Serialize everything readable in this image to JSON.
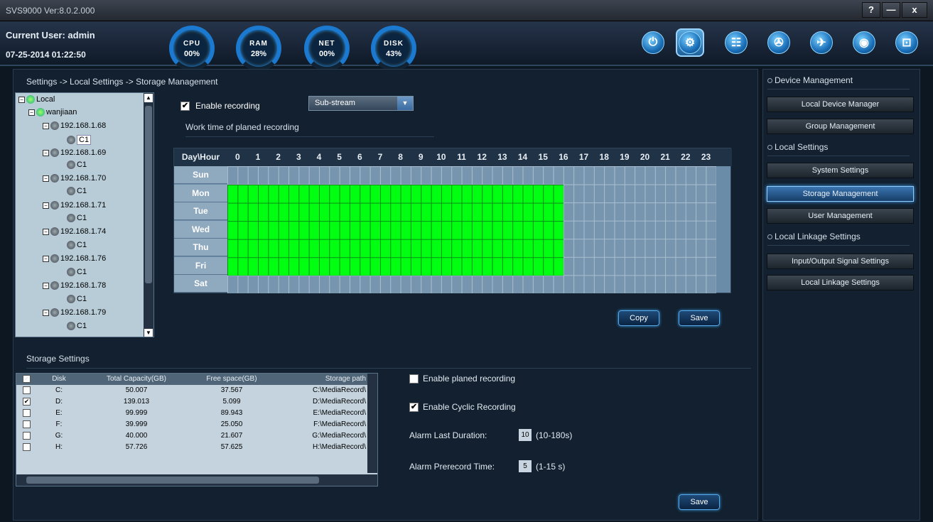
{
  "window": {
    "title": "SVS9000 Ver:8.0.2.000",
    "help": "?",
    "minimize": "—",
    "close": "x"
  },
  "header": {
    "user": "Current User: admin",
    "datetime": "07-25-2014 01:22:50",
    "gauges": [
      {
        "label": "CPU",
        "value": "00%"
      },
      {
        "label": "RAM",
        "value": "28%"
      },
      {
        "label": "NET",
        "value": "00%"
      },
      {
        "label": "DISK",
        "value": "43%"
      }
    ],
    "toolbar": [
      "power-icon",
      "settings-icon",
      "search-log-icon",
      "playback-icon",
      "map-icon",
      "camera-icon",
      "unlock-icon"
    ]
  },
  "breadcrumb": "Settings -> Local Settings -> Storage Management",
  "tree": {
    "root": "Local",
    "group": "wanjiaan",
    "devices": [
      {
        "ip": "192.168.1.68",
        "ch": "C1"
      },
      {
        "ip": "192.168.1.69",
        "ch": "C1"
      },
      {
        "ip": "192.168.1.70",
        "ch": "C1"
      },
      {
        "ip": "192.168.1.71",
        "ch": "C1"
      },
      {
        "ip": "192.168.1.74",
        "ch": "C1"
      },
      {
        "ip": "192.168.1.76",
        "ch": "C1"
      },
      {
        "ip": "192.168.1.78",
        "ch": "C1"
      },
      {
        "ip": "192.168.1.79",
        "ch": "C1"
      }
    ]
  },
  "recording": {
    "enable_label": "Enable recording",
    "enabled": true,
    "stream": "Sub-stream",
    "work_time_title": "Work time of planed recording"
  },
  "schedule": {
    "corner": "Day\\Hour",
    "hours": [
      "0",
      "1",
      "2",
      "3",
      "4",
      "5",
      "6",
      "7",
      "8",
      "9",
      "10",
      "11",
      "12",
      "13",
      "14",
      "15",
      "16",
      "17",
      "18",
      "19",
      "20",
      "21",
      "22",
      "23"
    ],
    "days": [
      "Sun",
      "Mon",
      "Tue",
      "Wed",
      "Thu",
      "Fri",
      "Sat"
    ],
    "recorded_days": [
      "Mon",
      "Tue",
      "Wed",
      "Thu",
      "Fri"
    ],
    "recorded_hours_from": 0,
    "recorded_hours_to": 16,
    "copy": "Copy",
    "save": "Save"
  },
  "storage": {
    "title": "Storage Settings",
    "columns": [
      "Disk",
      "Total Capacity(GB)",
      "Free space(GB)",
      "Storage path"
    ],
    "rows": [
      {
        "checked": false,
        "disk": "C:",
        "total": "50.007",
        "free": "37.567",
        "path": "C:\\MediaRecord\\"
      },
      {
        "checked": true,
        "disk": "D:",
        "total": "139.013",
        "free": "5.099",
        "path": "D:\\MediaRecord\\"
      },
      {
        "checked": false,
        "disk": "E:",
        "total": "99.999",
        "free": "89.943",
        "path": "E:\\MediaRecord\\"
      },
      {
        "checked": false,
        "disk": "F:",
        "total": "39.999",
        "free": "25.050",
        "path": "F:\\MediaRecord\\"
      },
      {
        "checked": false,
        "disk": "G:",
        "total": "40.000",
        "free": "21.607",
        "path": "G:\\MediaRecord\\"
      },
      {
        "checked": false,
        "disk": "H:",
        "total": "57.726",
        "free": "57.625",
        "path": "H:\\MediaRecord\\"
      }
    ],
    "enable_planed": "Enable planed recording",
    "enable_cyclic": "Enable Cyclic Recording",
    "alarm_duration_label": "Alarm Last Duration:",
    "alarm_duration": "10",
    "alarm_duration_range": "(10-180s)",
    "prerecord_label": "Alarm Prerecord Time:",
    "prerecord": "5",
    "prerecord_range": "(1-15 s)",
    "save": "Save"
  },
  "sidebar": {
    "sections": [
      {
        "title": "Device Management",
        "items": [
          "Local Device Manager",
          "Group Management"
        ]
      },
      {
        "title": "Local Settings",
        "items": [
          "System Settings",
          "Storage Management",
          "User Management"
        ]
      },
      {
        "title": "Local Linkage Settings",
        "items": [
          "Input/Output Signal Settings",
          "Local Linkage Settings"
        ]
      }
    ],
    "active": "Storage Management"
  }
}
